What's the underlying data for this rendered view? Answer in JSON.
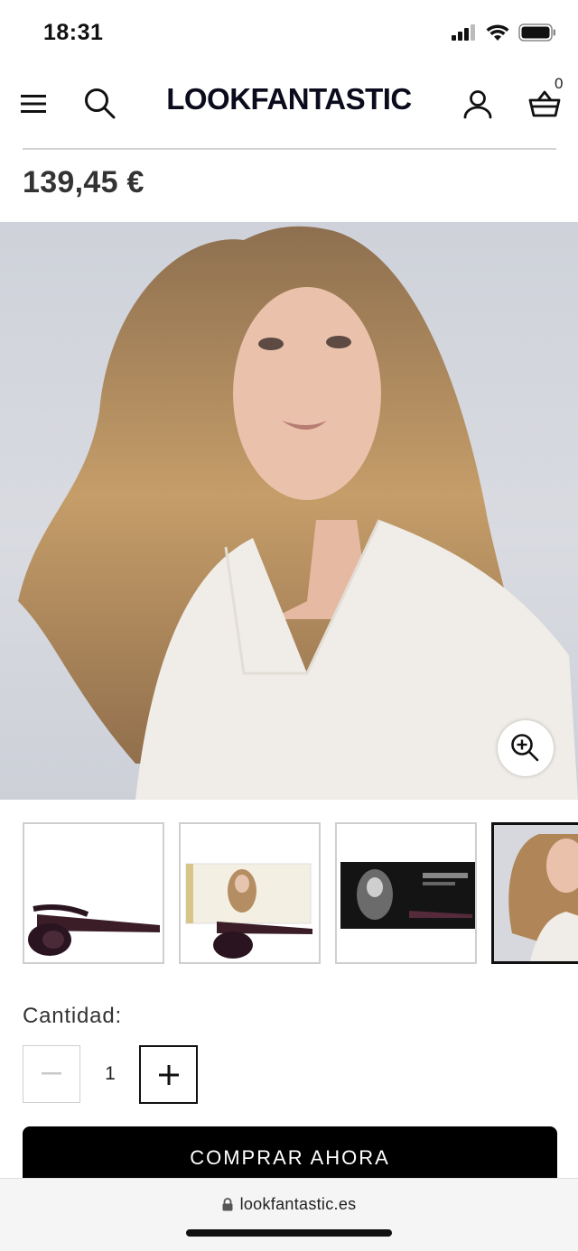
{
  "status_bar": {
    "time": "18:31"
  },
  "header": {
    "logo": "LOOKFANTASTIC",
    "bag_count": "0"
  },
  "product": {
    "price": "139,45 €"
  },
  "gallery": {
    "zoom_icon": "zoom-in-icon",
    "thumbnail_count": 4,
    "active_thumbnail": 4
  },
  "quantity": {
    "label": "Cantidad:",
    "value": "1"
  },
  "buy_button": {
    "label": "COMPRAR AHORA"
  },
  "browser": {
    "url": "lookfantastic.es"
  },
  "colors": {
    "primary": "#000000",
    "text": "#333333",
    "background": "#ffffff"
  }
}
